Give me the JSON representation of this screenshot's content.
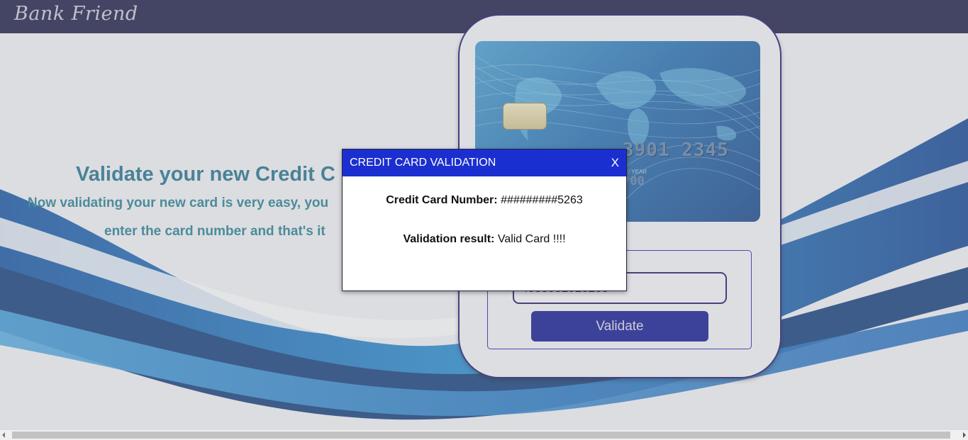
{
  "header": {
    "logo_text": "Bank Friend"
  },
  "hero": {
    "headline": "Validate your new Credit C",
    "subtext_line1": "Now validating your new card is very easy, you",
    "subtext_line2": "enter the card number and that's it"
  },
  "card_image": {
    "number_fragment": "3901 2345",
    "expiry_label_fragment": "H / YEAR",
    "expiry_fragment": "/00"
  },
  "form": {
    "card_number_value": "4083952015263",
    "validate_label": "Validate"
  },
  "modal": {
    "title": "CREDIT CARD VALIDATION",
    "close_label": "X",
    "card_number_label": "Credit Card Number:",
    "card_number_value": "#########5263",
    "result_label": "Validation result:",
    "result_value": "Valid Card !!!!"
  },
  "colors": {
    "topbar": "#13123e",
    "modal_header": "#1b2fd0",
    "validate_button": "#060f8c",
    "headline": "#1a6d8a"
  },
  "icons": {
    "close": "close-icon",
    "scroll_left": "chevron-left-icon",
    "scroll_right": "chevron-right-icon"
  }
}
